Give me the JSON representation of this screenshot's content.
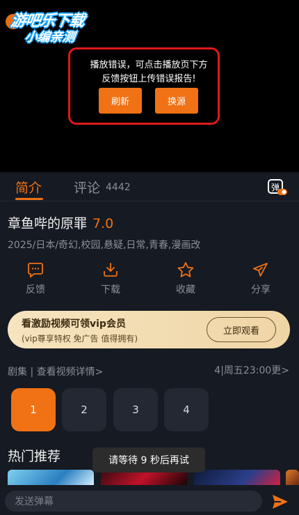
{
  "player": {
    "logo_line1": "游吧乐下载",
    "logo_line2": "小编亲测",
    "error_message": "播放错误，可点击播放页下方反馈按钮上传错误报告!",
    "refresh_label": "刷新",
    "switch_source_label": "换源"
  },
  "tabs": {
    "intro_label": "简介",
    "comment_label": "评论",
    "comment_count": "4442",
    "danmu_toggle_label": "弹"
  },
  "show": {
    "title": "章鱼哔的原罪",
    "score": "7.0",
    "meta": "2025/日本/奇幻,校园,悬疑,日常,青春,漫画改"
  },
  "actions": [
    {
      "label": "反馈",
      "icon": "feedback-icon"
    },
    {
      "label": "下载",
      "icon": "download-icon"
    },
    {
      "label": "收藏",
      "icon": "star-icon"
    },
    {
      "label": "分享",
      "icon": "share-icon"
    }
  ],
  "vip": {
    "title": "看激励视频可领vip会员",
    "subtitle": "(vip尊享特权 免广告 值得拥有)",
    "button_label": "立即观看"
  },
  "episodes": {
    "header": "剧集 | 查看视频详情>",
    "schedule": "4|周五23:00更>",
    "items": [
      "1",
      "2",
      "3",
      "4"
    ],
    "selected": "1"
  },
  "hot": {
    "title": "热门推荐"
  },
  "toast": "请等待 9 秒后再试",
  "bottom": {
    "danmu_placeholder": "发送弹幕"
  },
  "colors": {
    "accent": "#f07215",
    "background": "#161a22",
    "error_border": "#e01818",
    "vip_gold": "#f6e4bf"
  }
}
